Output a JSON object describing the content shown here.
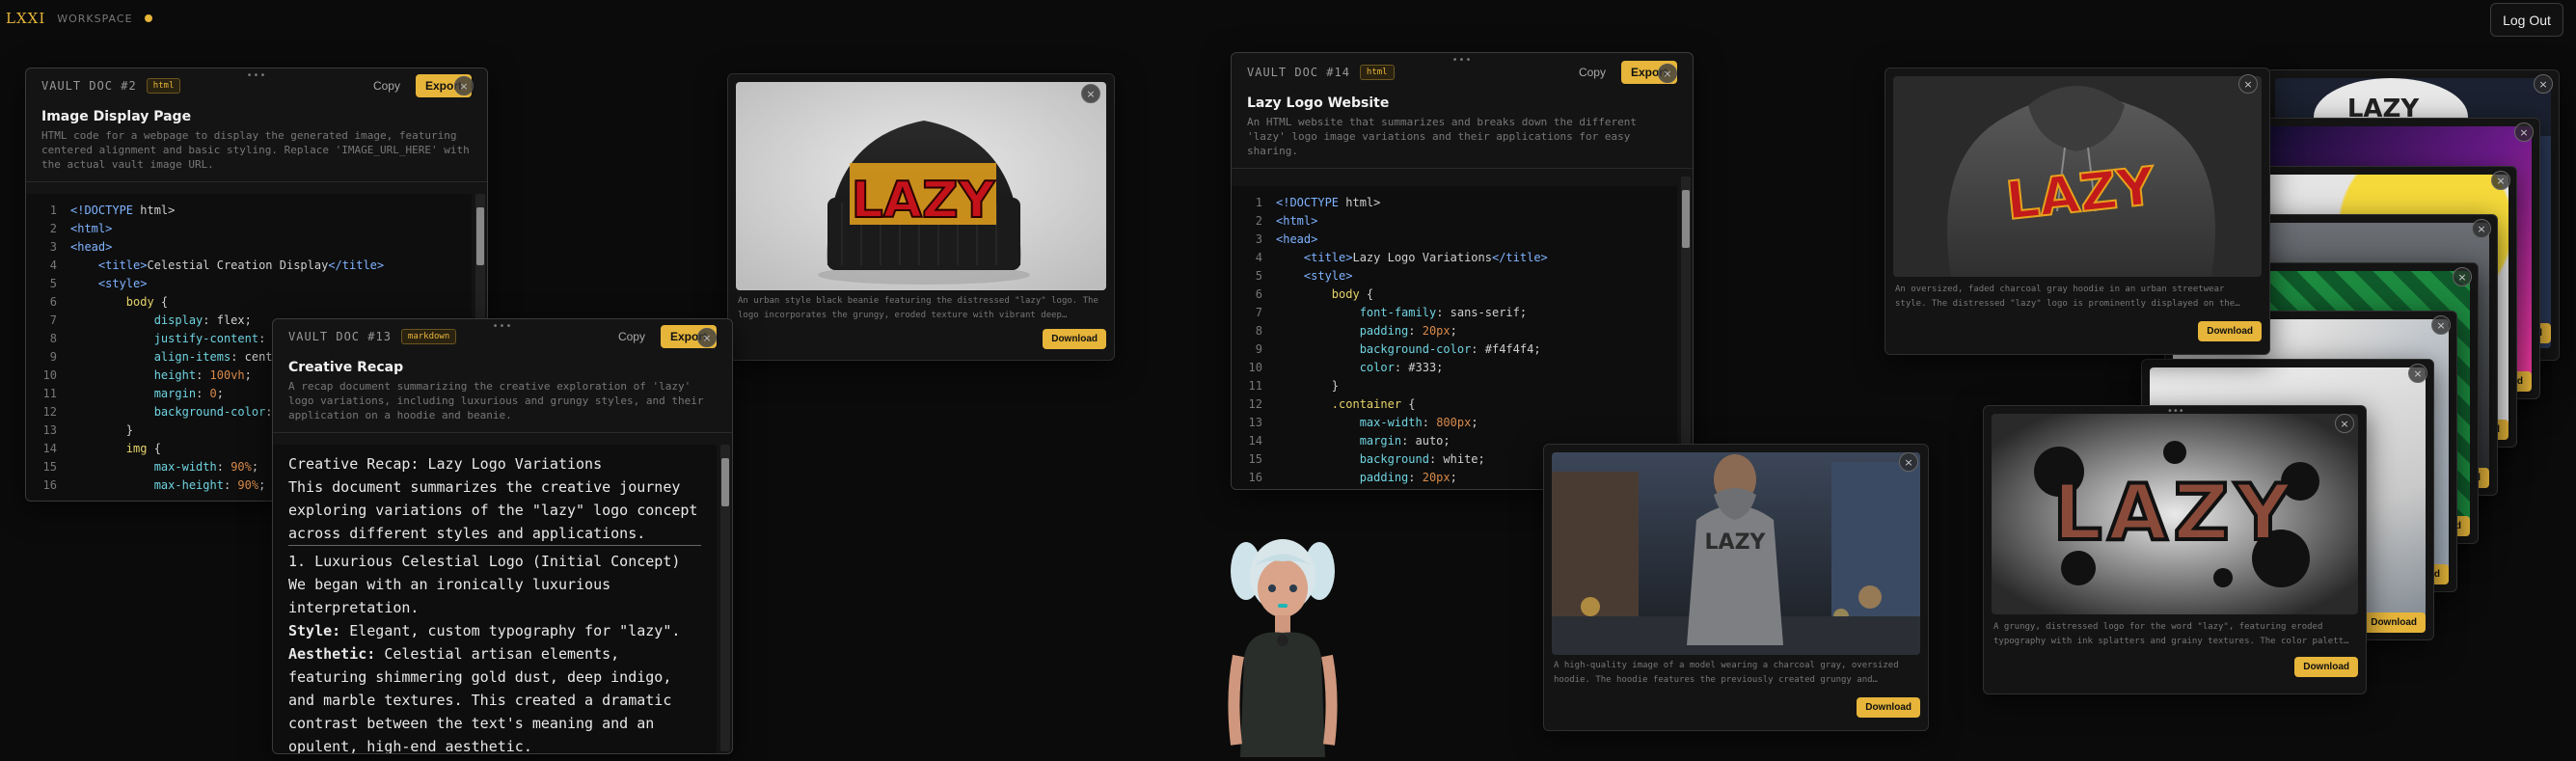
{
  "brand": {
    "logo": "LXXI",
    "workspace": "WORKSPACE"
  },
  "header": {
    "logout_label": "Log Out"
  },
  "common": {
    "copy": "Copy",
    "export": "Export",
    "download": "Download",
    "close": "×",
    "grip": "•••"
  },
  "docs": [
    {
      "label": "VAULT DOC #2",
      "badge": "html",
      "title": "Image Display Page",
      "description": "HTML code for a webpage to display the generated image, featuring centered alignment and basic styling. Replace 'IMAGE_URL_HERE' with the actual vault image URL.",
      "lines": [
        {
          "n": "1",
          "t": "<!DOCTYPE html>"
        },
        {
          "n": "2",
          "t": "<html>"
        },
        {
          "n": "3",
          "t": "<head>"
        },
        {
          "n": "4",
          "t": "    <title>Celestial Creation Display</title>"
        },
        {
          "n": "5",
          "t": "    <style>"
        },
        {
          "n": "6",
          "t": "        body {"
        },
        {
          "n": "7",
          "t": "            display: flex;"
        },
        {
          "n": "8",
          "t": "            justify-content: c"
        },
        {
          "n": "9",
          "t": "            align-items: cente"
        },
        {
          "n": "10",
          "t": "            height: 100vh;"
        },
        {
          "n": "11",
          "t": "            margin: 0;"
        },
        {
          "n": "12",
          "t": "            background-color:"
        },
        {
          "n": "13",
          "t": "        }"
        },
        {
          "n": "14",
          "t": "        img {"
        },
        {
          "n": "15",
          "t": "            max-width: 90%;"
        },
        {
          "n": "16",
          "t": "            max-height: 90%;"
        }
      ]
    },
    {
      "label": "VAULT DOC #13",
      "badge": "markdown",
      "title": "Creative Recap",
      "description": "A recap document summarizing the creative exploration of 'lazy' logo variations, including luxurious and grungy styles, and their application on a hoodie and beanie.",
      "md": {
        "heading": "Creative Recap: Lazy Logo Variations",
        "intro": "This document summarizes the creative journey exploring variations of the \"lazy\" logo concept across different styles and applications.",
        "section1": "1. Luxurious Celestial Logo (Initial Concept)",
        "section1_text": "We began with an ironically luxurious interpretation.",
        "style_label": "Style:",
        "style_text": " Elegant, custom typography for \"lazy\".",
        "aesthetic_label": "Aesthetic:",
        "aesthetic_text": " Celestial artisan elements, featuring shimmering gold dust, deep indigo, and marble textures. This created a dramatic contrast between the text's meaning and an opulent, high-end aesthetic."
      }
    },
    {
      "label": "VAULT DOC #14",
      "badge": "html",
      "title": "Lazy Logo Website",
      "description": "An HTML website that summarizes and breaks down the different 'lazy' logo image variations and their applications for easy sharing.",
      "lines": [
        {
          "n": "1",
          "t": "<!DOCTYPE html>"
        },
        {
          "n": "2",
          "t": "<html>"
        },
        {
          "n": "3",
          "t": "<head>"
        },
        {
          "n": "4",
          "t": "    <title>Lazy Logo Variations</title>"
        },
        {
          "n": "5",
          "t": "    <style>"
        },
        {
          "n": "6",
          "t": "        body {"
        },
        {
          "n": "7",
          "t": "            font-family: sans-serif;"
        },
        {
          "n": "8",
          "t": "            padding: 20px;"
        },
        {
          "n": "9",
          "t": "            background-color: #f4f4f4;"
        },
        {
          "n": "10",
          "t": "            color: #333;"
        },
        {
          "n": "11",
          "t": "        }"
        },
        {
          "n": "12",
          "t": "        .container {"
        },
        {
          "n": "13",
          "t": "            max-width: 800px;"
        },
        {
          "n": "14",
          "t": "            margin: auto;"
        },
        {
          "n": "15",
          "t": "            background: white;"
        },
        {
          "n": "16",
          "t": "            padding: 20px;"
        }
      ]
    }
  ],
  "images": {
    "beanie": {
      "caption": "An urban style black beanie featuring the distressed \"lazy\" logo. The logo incorporates the grungy, eroded texture with vibrant deep…",
      "art_text": "LAZY"
    },
    "model": {
      "caption": "A high-quality image of a model wearing a charcoal gray, oversized hoodie. The hoodie features the previously created grungy and…",
      "art_text": "LAZY"
    },
    "hoodie": {
      "caption": "An oversized, faded charcoal gray hoodie in an urban streetwear style. The distressed \"lazy\" logo is prominently displayed on the…",
      "art_text": "LAZY"
    },
    "grunge": {
      "caption": "A grungy, distressed logo for the word \"lazy\", featuring eroded typography with ink splatters and grainy textures. The color palett…",
      "art_text": "LAZY"
    },
    "stack_top": {
      "art_text": "LAZY"
    }
  }
}
